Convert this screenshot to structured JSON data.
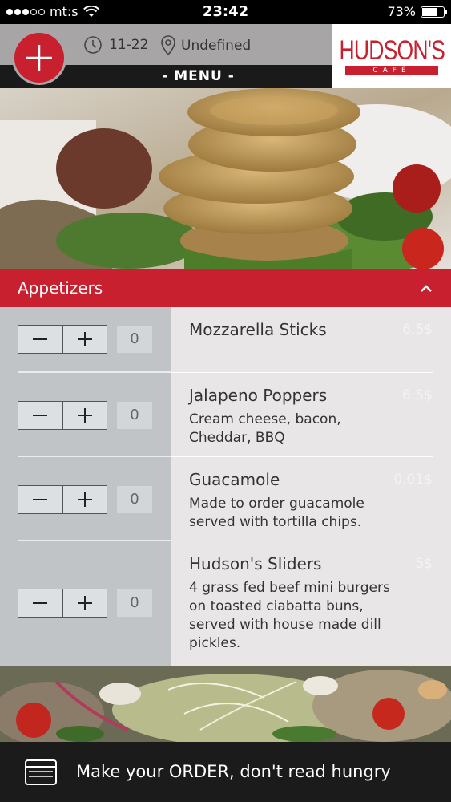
{
  "status_bar": {
    "carrier": "mt:s",
    "time": "23:42",
    "battery": "73%",
    "battery_level": 0.73
  },
  "header": {
    "hours": "11-22",
    "location": "Undefined",
    "menu_title": "- MENU -",
    "logo_main": "HUDSON'S",
    "logo_sub": "CAFÉ"
  },
  "category": {
    "title": "Appetizers"
  },
  "items": [
    {
      "name": "Mozzarella Sticks",
      "description": "",
      "price": "6.5$",
      "quantity": "0"
    },
    {
      "name": "Jalapeno Poppers",
      "description": "Cream cheese, bacon, Cheddar, BBQ",
      "price": "6.5$",
      "quantity": "0"
    },
    {
      "name": "Guacamole",
      "description": "Made to order guacamole served with tortilla chips.",
      "price": "0.01$",
      "quantity": "0"
    },
    {
      "name": "Hudson's Sliders",
      "description": "4 grass fed beef mini burgers on toasted ciabatta buns, served with house made dill pickles.",
      "price": "5$",
      "quantity": "0"
    }
  ],
  "footer": {
    "text": "Make your ORDER, don't read hungry"
  },
  "colors": {
    "accent": "#c8202f",
    "header_gray": "#a7a5a5",
    "footer_bg": "#1b1b1b"
  }
}
